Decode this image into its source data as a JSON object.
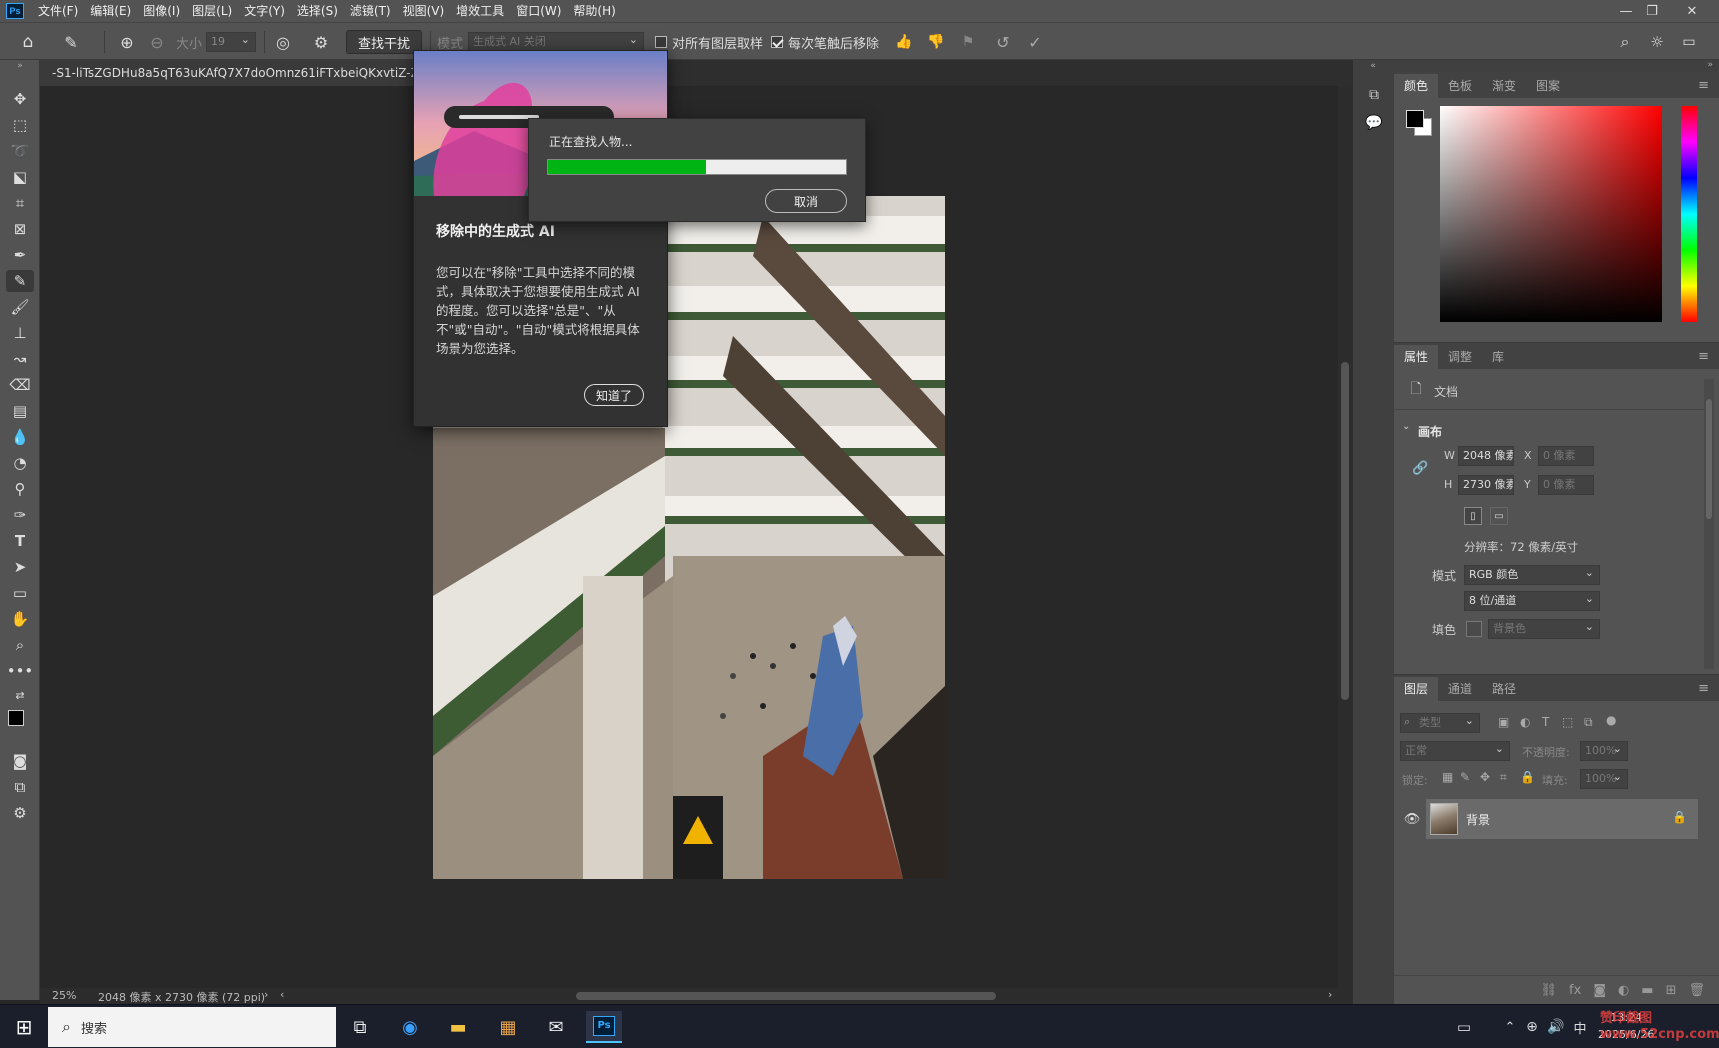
{
  "app": {
    "logo": "Ps"
  },
  "menu": [
    "文件(F)",
    "编辑(E)",
    "图像(I)",
    "图层(L)",
    "文字(Y)",
    "选择(S)",
    "滤镜(T)",
    "视图(V)",
    "增效工具",
    "窗口(W)",
    "帮助(H)"
  ],
  "options": {
    "size_label": "大小",
    "size_value": "19",
    "find_distractions": "查找干扰",
    "mode_label": "模式",
    "mode_value": "生成式 AI 关闭",
    "sample_all_layers": "对所有图层取样",
    "remove_after_stroke": "每次笔触后移除"
  },
  "document": {
    "tab_title": "-S1-liTsZGDHu8a5qT63uKAfQ7X7doOmnz61iFTxbeiQKxvtiZ-ZzBHEp...",
    "zoom": "25%",
    "info": "2048 像素 x 2730 像素 (72 ppi)"
  },
  "progress": {
    "message": "正在查找人物...",
    "percent": 53,
    "cancel": "取消"
  },
  "tip": {
    "title": "移除中的生成式 AI",
    "body": "您可以在\"移除\"工具中选择不同的模式，具体取决于您想要使用生成式 AI 的程度。您可以选择\"总是\"、\"从不\"或\"自动\"。\"自动\"模式将根据具体场景为您选择。",
    "ok": "知道了"
  },
  "color_panel": {
    "tabs": [
      "颜色",
      "色板",
      "渐变",
      "图案"
    ],
    "active": 0
  },
  "properties_panel": {
    "tabs": [
      "属性",
      "调整",
      "库"
    ],
    "doc_label": "文档",
    "section": "画布",
    "w_label": "W",
    "w_value": "2048 像素",
    "h_label": "H",
    "h_value": "2730 像素",
    "x_label": "X",
    "x_value": "0 像素",
    "y_label": "Y",
    "y_value": "0 像素",
    "resolution": "分辨率：72 像素/英寸",
    "mode_label": "模式",
    "mode_value": "RGB 颜色",
    "depth_value": "8 位/通道",
    "fill_label": "填色",
    "fill_value": "背景色"
  },
  "layers_panel": {
    "tabs": [
      "图层",
      "通道",
      "路径"
    ],
    "filter_placeholder": "类型",
    "blend_mode": "正常",
    "opacity_label": "不透明度:",
    "opacity_value": "100%",
    "lock_label": "锁定:",
    "fill_label": "填充:",
    "fill_value": "100%",
    "layer_name": "背景"
  },
  "taskbar": {
    "search": "搜索",
    "time": "13:24",
    "date": "2025/6/26",
    "lang": "中",
    "watermark": "赞印截图 www.52cnp.com"
  },
  "colors": {
    "accent": "#31a8ff",
    "progress": "#00b414",
    "panel": "#535353"
  }
}
